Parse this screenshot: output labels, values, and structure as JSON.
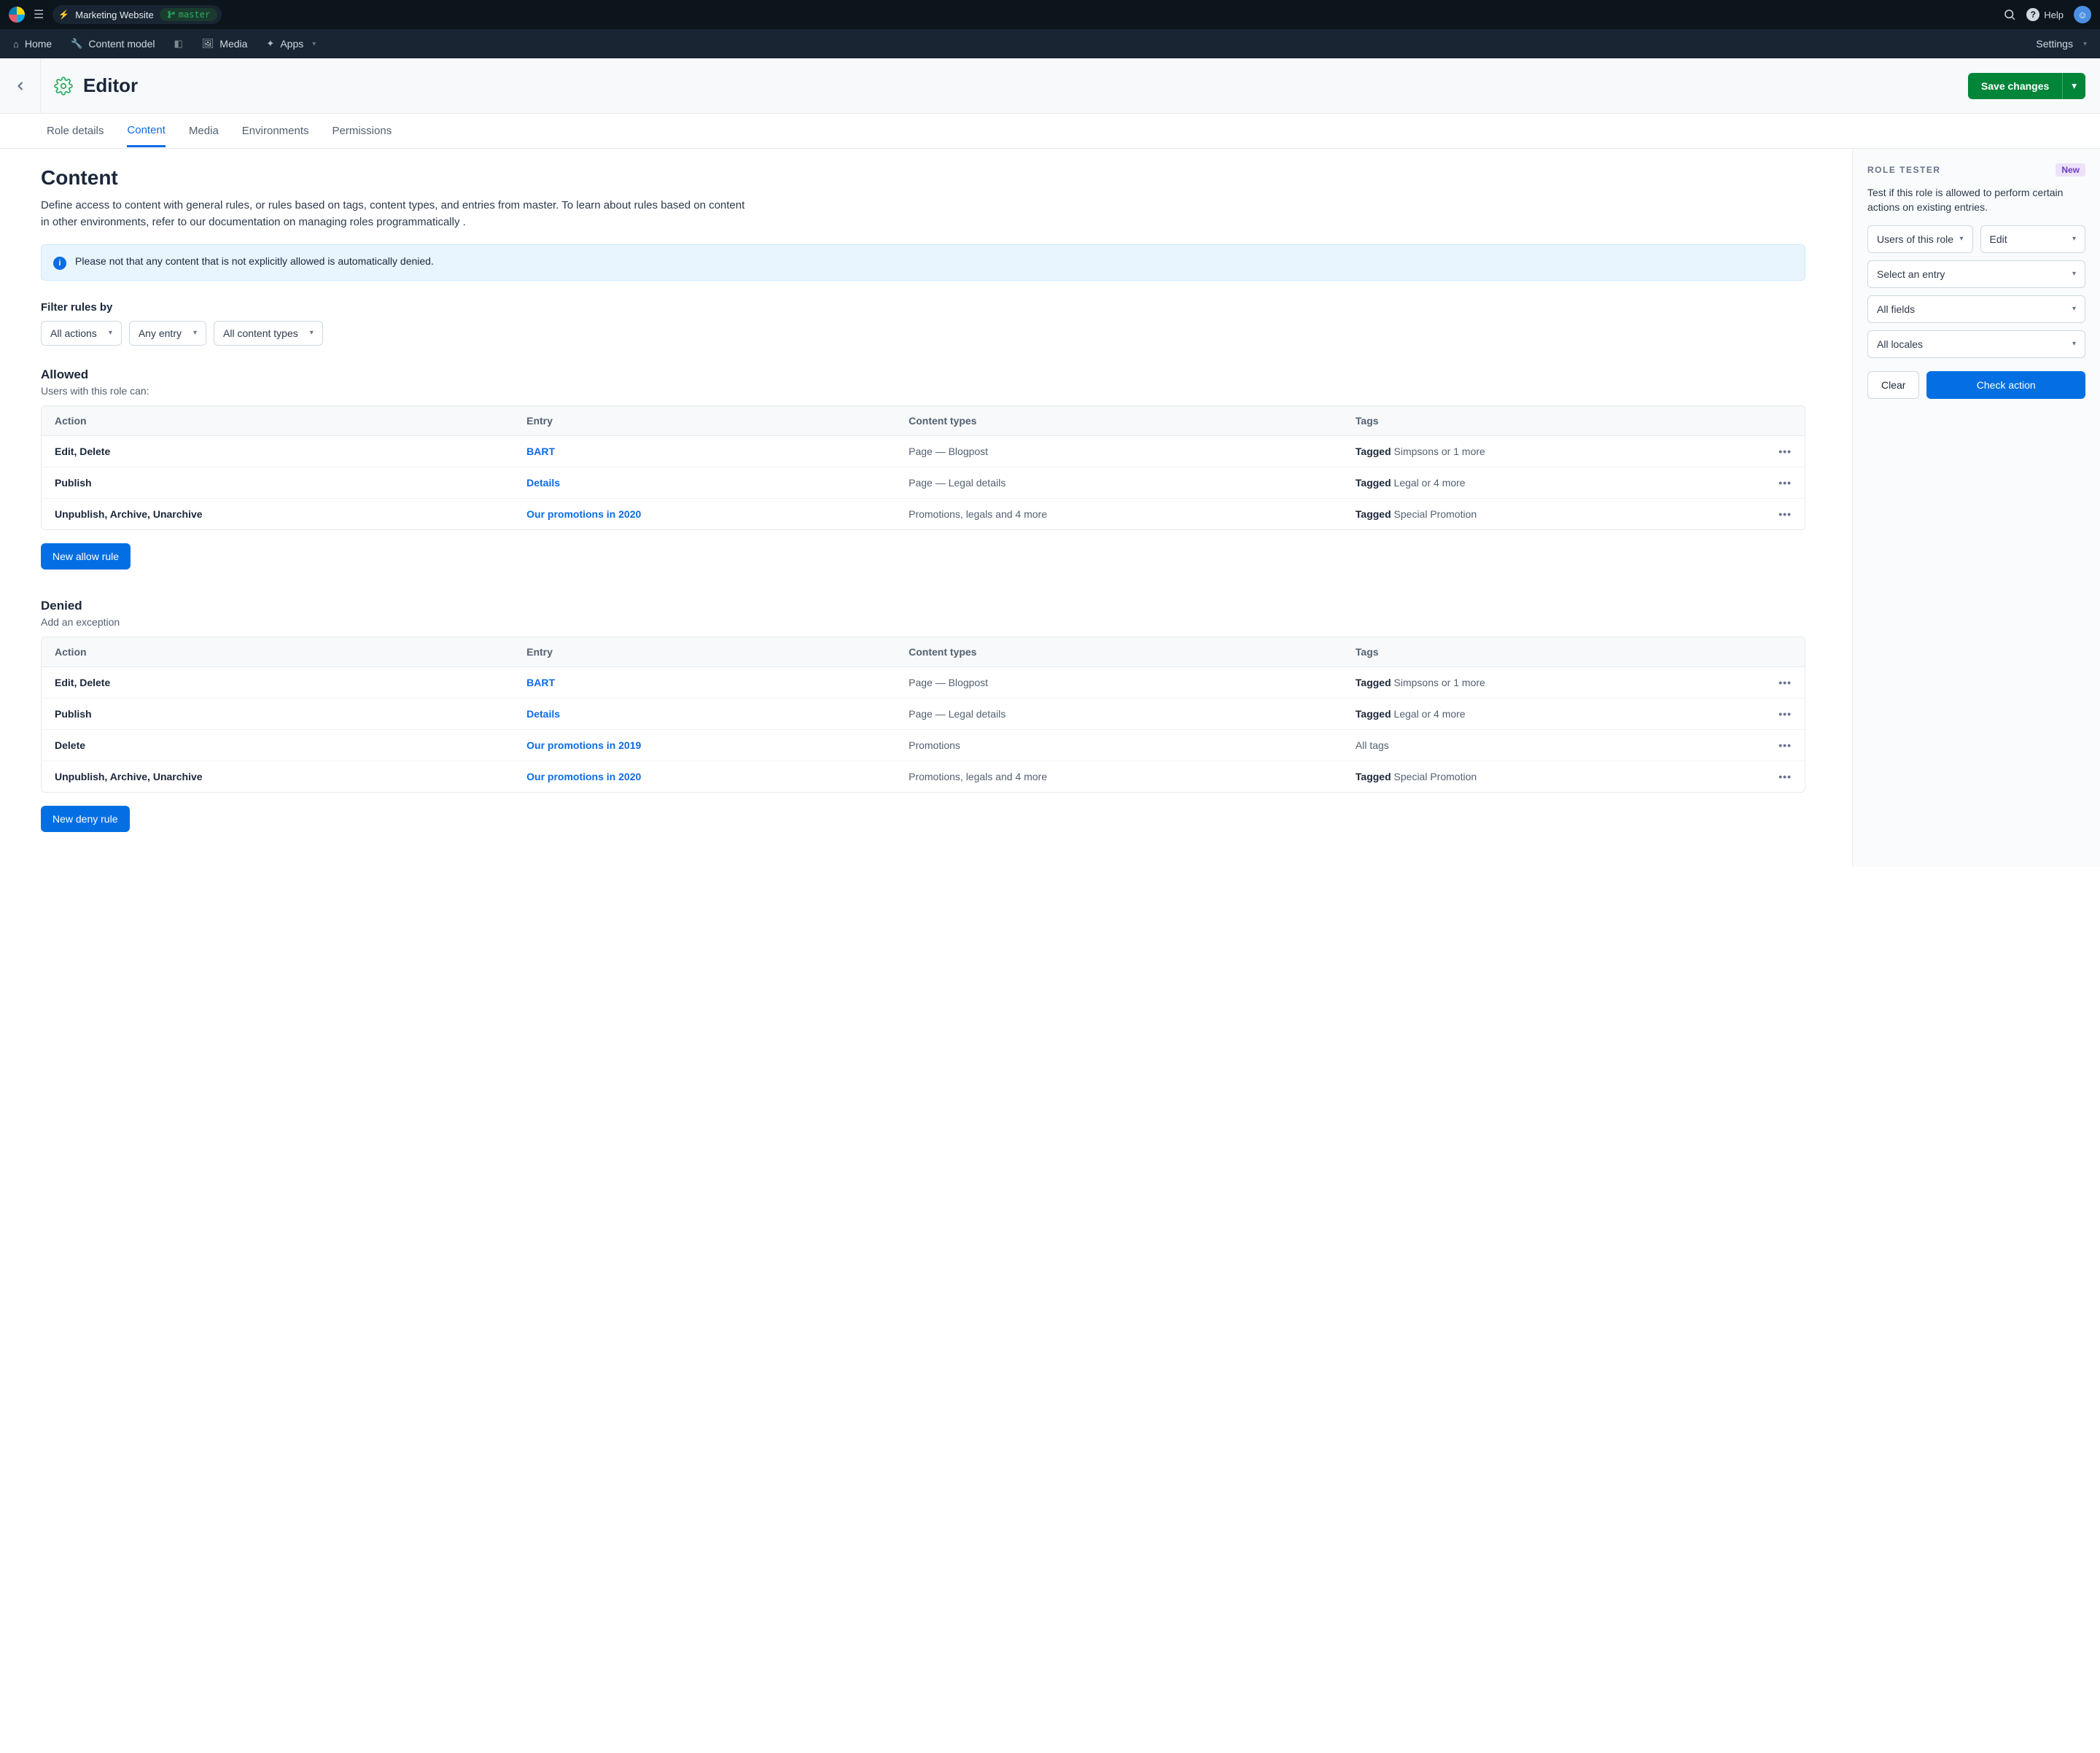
{
  "topbar": {
    "space_name": "Marketing Website",
    "env_badge": "master",
    "help_label": "Help"
  },
  "nav": {
    "home": "Home",
    "content_model": "Content model",
    "media": "Media",
    "apps": "Apps",
    "settings": "Settings"
  },
  "header": {
    "title": "Editor",
    "save_label": "Save changes"
  },
  "tabs": [
    "Role details",
    "Content",
    "Media",
    "Environments",
    "Permissions"
  ],
  "active_tab": "Content",
  "content": {
    "title": "Content",
    "description": "Define access to content with general rules, or rules based on tags, content types, and entries from master. To learn about rules based on content in other environments, refer to our documentation on managing roles programmatically .",
    "note": "Please not that any content that is not explicitly allowed is automatically denied.",
    "filter_title": "Filter rules by",
    "filters": {
      "actions": "All actions",
      "entry": "Any entry",
      "ctypes": "All content types"
    },
    "allowed": {
      "title": "Allowed",
      "caption": "Users with this role can:",
      "columns": [
        "Action",
        "Entry",
        "Content types",
        "Tags"
      ],
      "rows": [
        {
          "action": "Edit, Delete",
          "entry": "BART",
          "ctypes": "Page — Blogpost",
          "tagged": "Tagged",
          "tagrest": "Simpsons or 1 more"
        },
        {
          "action": "Publish",
          "entry": "Details",
          "ctypes": "Page — Legal details",
          "tagged": "Tagged",
          "tagrest": "Legal or 4 more"
        },
        {
          "action": "Unpublish, Archive, Unarchive",
          "entry": "Our promotions in 2020",
          "ctypes": "Promotions, legals and 4 more",
          "tagged": "Tagged",
          "tagrest": "Special Promotion"
        }
      ],
      "button": "New allow rule"
    },
    "denied": {
      "title": "Denied",
      "caption": "Add an exception",
      "columns": [
        "Action",
        "Entry",
        "Content types",
        "Tags"
      ],
      "rows": [
        {
          "action": "Edit, Delete",
          "entry": "BART",
          "ctypes": "Page — Blogpost",
          "tagged": "Tagged",
          "tagrest": "Simpsons or 1 more"
        },
        {
          "action": "Publish",
          "entry": "Details",
          "ctypes": "Page — Legal details",
          "tagged": "Tagged",
          "tagrest": "Legal or 4 more"
        },
        {
          "action": "Delete",
          "entry": "Our promotions in 2019",
          "ctypes": "Promotions",
          "tagged": "",
          "tagrest": "All tags"
        },
        {
          "action": "Unpublish, Archive, Unarchive",
          "entry": "Our promotions in 2020",
          "ctypes": "Promotions, legals and 4 more",
          "tagged": "Tagged",
          "tagrest": "Special Promotion"
        }
      ],
      "button": "New deny rule"
    }
  },
  "tester": {
    "title": "Role Tester",
    "badge": "New",
    "desc": "Test if this role is allowed to perform certain actions on existing entries.",
    "users": "Users of this role",
    "action": "Edit",
    "entry": "Select an entry",
    "fields": "All fields",
    "locales": "All locales",
    "clear": "Clear",
    "check": "Check action"
  }
}
